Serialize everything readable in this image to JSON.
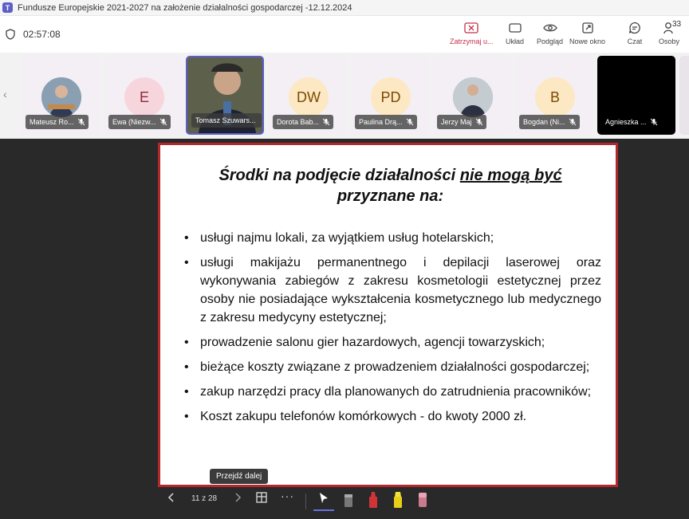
{
  "window": {
    "title": "Fundusze Europejskie 2021-2027 na założenie działalności gospodarczej -12.12.2024"
  },
  "toolbar": {
    "timer": "02:57:08",
    "stop_label": "Zatrzymaj u...",
    "layout_label": "Układ",
    "preview_label": "Podgląd",
    "new_window_label": "Nowe okno",
    "chat_label": "Czat",
    "people_label": "Osoby",
    "people_count": "33"
  },
  "participants": [
    {
      "name": "Mateusz Ro...",
      "type": "photo"
    },
    {
      "name": "Ewa (Niezw...",
      "type": "initials",
      "initials": "E",
      "bg": "#f6d6dc",
      "fg": "#8a2a3b"
    },
    {
      "name": "Tomasz Szuwars...",
      "type": "video"
    },
    {
      "name": "Dorota Bab...",
      "type": "initials",
      "initials": "DW",
      "bg": "#fde8c4",
      "fg": "#7a4a00"
    },
    {
      "name": "Paulina Drą...",
      "type": "initials",
      "initials": "PD",
      "bg": "#fde8c4",
      "fg": "#7a4a00"
    },
    {
      "name": "Jerzy Maj",
      "type": "photo"
    },
    {
      "name": "Bogdan (Ni...",
      "type": "initials",
      "initials": "B",
      "bg": "#fde8c4",
      "fg": "#7a4a00"
    },
    {
      "name": "Agnieszka ...",
      "type": "dark"
    }
  ],
  "slide": {
    "title_a": "Środki na podjęcie działalności ",
    "title_b": "nie mogą być",
    "title_c": "przyznane na:",
    "bullets": [
      "usługi najmu lokali, za wyjątkiem usług hotelarskich;",
      "usługi makijażu permanentnego i depilacji laserowej oraz wykonywania zabiegów z zakresu kosmetologii estetycznej przez osoby nie posiadające wykształcenia kosmetycznego  lub medycznego z zakresu medycyny estetycznej;",
      "prowadzenie salonu gier hazardowych, agencji towarzyskich;",
      "bieżące koszty związane z prowadzeniem działalności gospodarczej;",
      "zakup narzędzi pracy dla planowanych do zatrudnienia pracowników;",
      "Koszt zakupu telefonów komórkowych - do kwoty 2000 zł."
    ]
  },
  "presenter": {
    "page": "11 z 28",
    "tooltip": "Przejdź dalej"
  },
  "colors": {
    "accent": "#5b5fc7",
    "stop": "#c4314b",
    "slide_border": "#b3282d",
    "stage": "#292929"
  }
}
